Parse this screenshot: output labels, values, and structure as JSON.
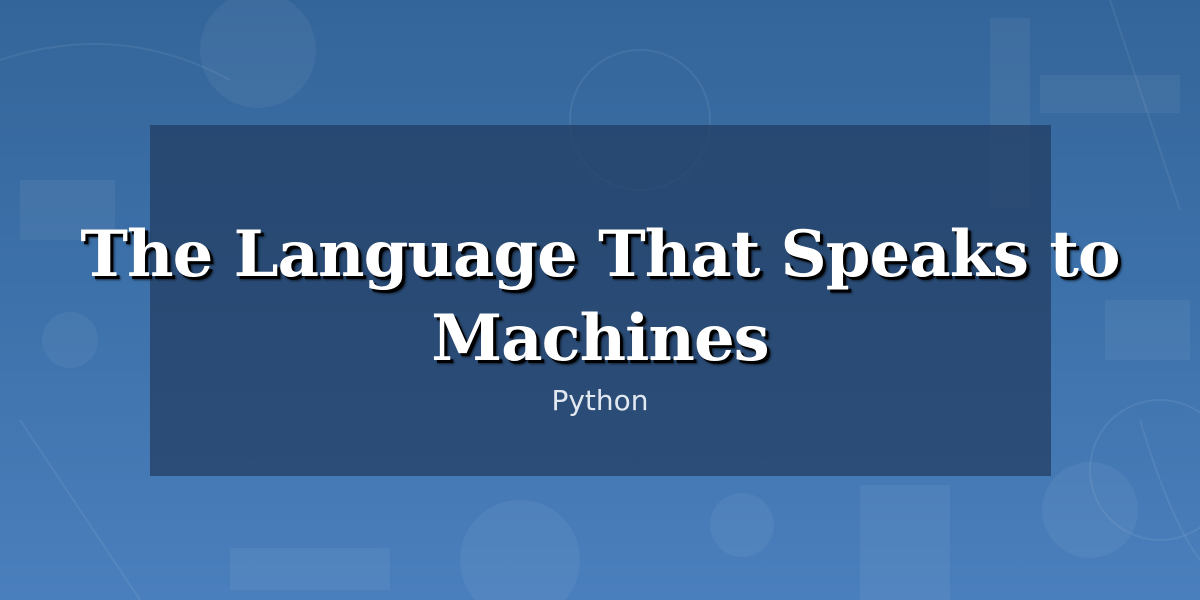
{
  "title": "The Language That Speaks to Machines",
  "subtitle": "Python",
  "colors": {
    "background": "#3c70a8",
    "panel": "#213b60",
    "title_text": "#ffffff",
    "title_shadow": "#000000",
    "subtitle_text": "#e2e8f0"
  }
}
